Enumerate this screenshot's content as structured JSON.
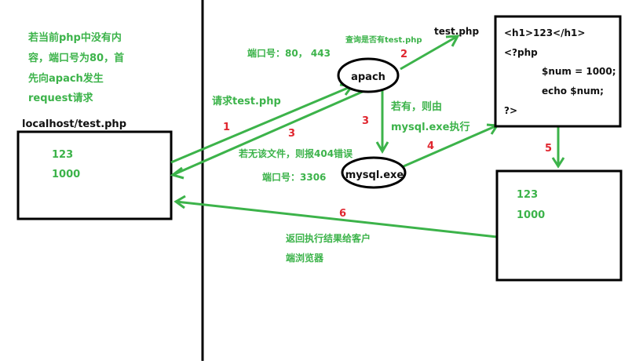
{
  "left_note": [
    "若当前php中没有内",
    "容，端口号为80，首",
    "先向apach发生",
    "request请求"
  ],
  "client": {
    "title": "localhost/test.php",
    "line1": "123",
    "line2": "1000"
  },
  "apache": {
    "label": "apach",
    "port_label": "端口号：80， 443"
  },
  "mysql": {
    "label": "mysql.exe",
    "port_label": "端口号：3306"
  },
  "file": {
    "label": "test.php",
    "query_label": "查询是否有test.php"
  },
  "code": [
    "<h1>123</h1>",
    "<?php",
    "$num = 1000;",
    "echo $num;",
    "?>"
  ],
  "result": {
    "line1": "123",
    "line2": "1000"
  },
  "steps": {
    "s1": {
      "num": "1",
      "label": "请求test.php"
    },
    "s2": {
      "num": "2"
    },
    "s3a": {
      "num": "3",
      "label": "若无该文件，则报404错误"
    },
    "s3b": {
      "num": "3",
      "label1": "若有，则由",
      "label2": "mysql.exe执行"
    },
    "s4": {
      "num": "4"
    },
    "s5": {
      "num": "5"
    },
    "s6": {
      "num": "6",
      "label1": "返回执行结果给客户",
      "label2": "端浏览器"
    }
  },
  "colors": {
    "green": "#3cb34a",
    "red": "#e0262f",
    "black": "#000000"
  }
}
